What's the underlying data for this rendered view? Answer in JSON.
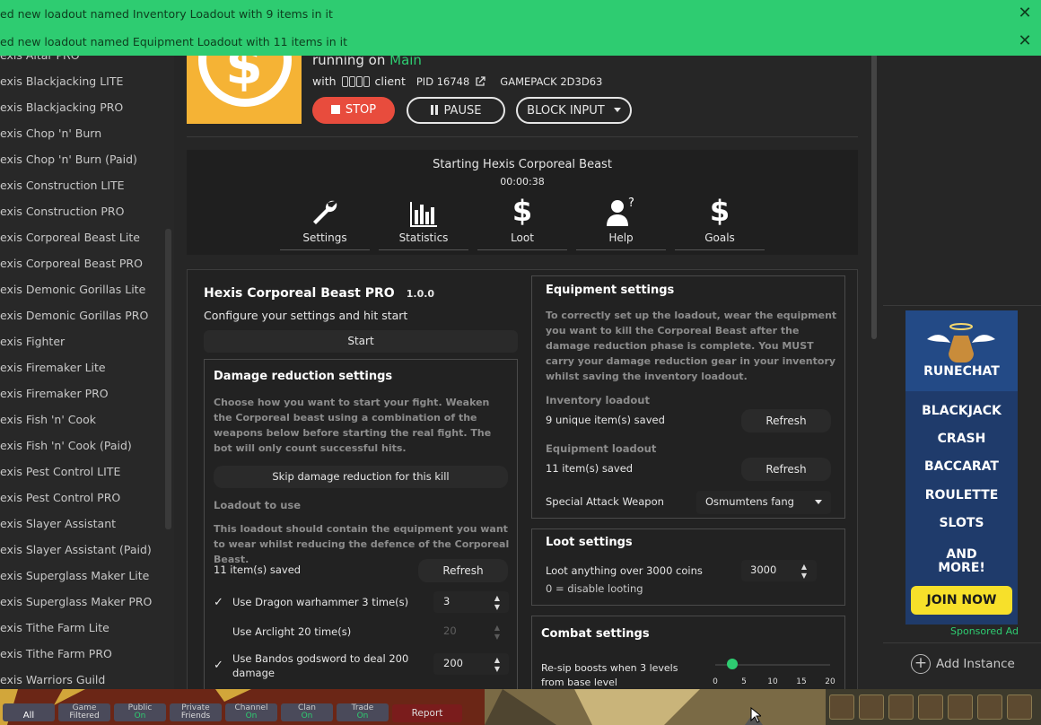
{
  "notifications": [
    {
      "text": "ed new loadout named Inventory Loadout with 9 items in it"
    },
    {
      "text": "ed new loadout named Equipment Loadout with 11 items in it"
    }
  ],
  "sidebar": {
    "items": [
      "exis Altar PRO",
      "exis Blackjacking LITE",
      "exis Blackjacking PRO",
      "exis Chop 'n' Burn",
      "exis Chop 'n' Burn (Paid)",
      "exis Construction LITE",
      "exis Construction PRO",
      "exis Corporeal Beast Lite",
      "exis Corporeal Beast PRO",
      "exis Demonic Gorillas Lite",
      "exis Demonic Gorillas PRO",
      "exis Fighter",
      "exis Firemaker Lite",
      "exis Firemaker PRO",
      "exis Fish 'n' Cook",
      "exis Fish 'n' Cook (Paid)",
      "exis Pest Control LITE",
      "exis Pest Control PRO",
      "exis Slayer Assistant",
      "exis Slayer Assistant (Paid)",
      "exis Superglass Maker Lite",
      "exis Superglass Maker PRO",
      "exis Tithe Farm Lite",
      "exis Tithe Farm PRO",
      "exis Warriors Guild"
    ]
  },
  "header": {
    "running_prefix": "running on",
    "running_world": "Main",
    "with_label": "with",
    "client_label": "client",
    "pid": "PID 16748",
    "gamepack": "GAMEPACK 2D3D63",
    "stop_label": "STOP",
    "pause_label": "PAUSE",
    "block_input_label": "BLOCK INPUT"
  },
  "status": {
    "title": "Starting Hexis Corporeal Beast",
    "timer": "00:00:38",
    "tools": [
      "Settings",
      "Statistics",
      "Loot",
      "Help",
      "Goals"
    ]
  },
  "script": {
    "name": "Hexis Corporeal Beast PRO",
    "version": "1.0.0",
    "subtitle": "Configure your settings and hit start",
    "start_label": "Start"
  },
  "damage_reduction": {
    "title": "Damage reduction settings",
    "description": "Choose how you want to start your fight. Weaken the Corporeal beast using a combination of the weapons below before starting the real fight. The bot will only count successful hits.",
    "skip_label": "Skip damage reduction for this kill",
    "loadout_title": "Loadout to use",
    "loadout_desc": "This loadout should contain the equipment you want to wear whilst reducing the defence of the Corporeal Beast.",
    "saved_text": "11 item(s) saved",
    "refresh_label": "Refresh",
    "options": [
      {
        "label": "Use Dragon warhammer 3 time(s)",
        "value": "3",
        "checked": true
      },
      {
        "label": "Use Arclight 20 time(s)",
        "value": "20",
        "checked": false
      },
      {
        "label": "Use Bandos godsword to deal 200 damage",
        "value": "200",
        "checked": true
      }
    ]
  },
  "equipment": {
    "title": "Equipment settings",
    "description": "To correctly set up the loadout, wear the equipment you want to kill the Corporeal Beast after the damage reduction phase is complete. You MUST carry your damage reduction gear in your inventory whilst saving the inventory loadout.",
    "inventory_title": "Inventory loadout",
    "inventory_saved": "9 unique item(s) saved",
    "equipment_title": "Equipment loadout",
    "equipment_saved": "11 item(s) saved",
    "refresh_label": "Refresh",
    "special_label": "Special Attack Weapon",
    "special_value": "Osmumtens fang"
  },
  "loot": {
    "title": "Loot settings",
    "label": "Loot anything over 3000 coins",
    "value": "3000",
    "note": "0 = disable looting"
  },
  "combat": {
    "title": "Combat settings",
    "label": "Re-sip boosts when 3 levels from base level",
    "ticks": [
      "0",
      "5",
      "10",
      "15",
      "20"
    ],
    "slider_value": 3,
    "slider_max": 20
  },
  "ad": {
    "brand": "RUNECHAT",
    "lines": [
      "BLACKJACK",
      "CRASH",
      "BACCARAT",
      "ROULETTE",
      "SLOTS",
      "AND",
      "MORE!"
    ],
    "cta": "JOIN NOW",
    "sponsored": "Sponsored Ad"
  },
  "add_instance_label": "Add Instance",
  "chat": {
    "buttons": [
      {
        "top": "",
        "bottom": "All"
      },
      {
        "top": "Game",
        "bottom": "Filtered"
      },
      {
        "top": "Public",
        "bottom": "On"
      },
      {
        "top": "Private",
        "bottom": "Friends"
      },
      {
        "top": "Channel",
        "bottom": "On"
      },
      {
        "top": "Clan",
        "bottom": "On"
      },
      {
        "top": "Trade",
        "bottom": "On"
      }
    ],
    "report_label": "Report"
  },
  "colors": {
    "accent_green": "#2ecc71",
    "stop_red": "#e84c3d",
    "logo_orange": "#f5b335"
  }
}
